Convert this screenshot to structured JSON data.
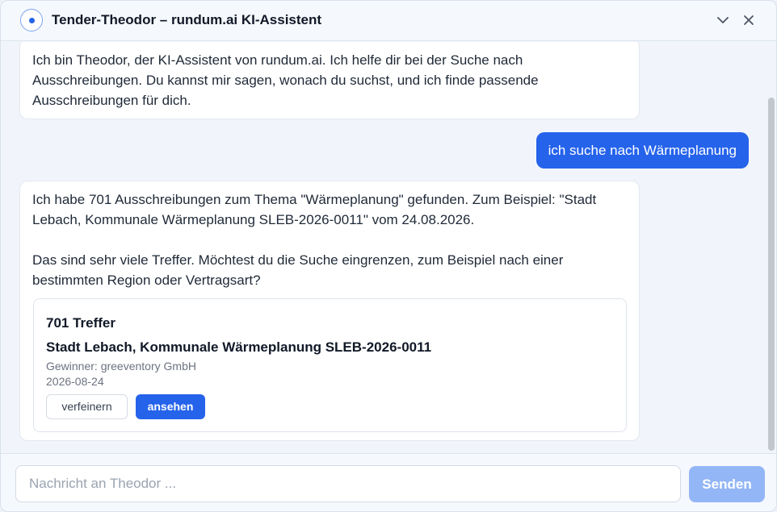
{
  "header": {
    "title": "Tender-Theodor – rundum.ai KI-Assistent",
    "icons": {
      "logo": "assistant-dot-icon",
      "collapse": "chevron-down-icon",
      "close": "close-icon"
    }
  },
  "messages": {
    "bot_intro": "Ich bin Theodor, der KI-Assistent von rundum.ai. Ich helfe dir bei der Suche nach Ausschreibungen. Du kannst mir sagen, wonach du suchst, und ich finde passende Ausschreibungen für dich.",
    "user_query": "ich suche nach Wärmeplanung",
    "bot_result_p1": "Ich habe 701 Ausschreibungen zum Thema \"Wärmeplanung\" gefunden. Zum Beispiel: \"Stadt Lebach, Kommunale Wärmeplanung SLEB-2026-0011\" vom 24.08.2026.",
    "bot_result_p2": "Das sind sehr viele Treffer. Möchtest du die Suche eingrenzen, zum Beispiel nach einer bestimmten Region oder Vertragsart?"
  },
  "result_card": {
    "count": "701 Treffer",
    "title": "Stadt Lebach, Kommunale Wärmeplanung SLEB-2026-0011",
    "winner": "Gewinner: greeventory GmbH",
    "date": "2026-08-24",
    "refine_label": "verfeinern",
    "view_label": "ansehen"
  },
  "composer": {
    "placeholder": "Nachricht an Theodor ...",
    "send_label": "Senden"
  },
  "colors": {
    "accent": "#2563eb",
    "send_disabled": "#93b6f6",
    "background": "#f1f5fb"
  }
}
